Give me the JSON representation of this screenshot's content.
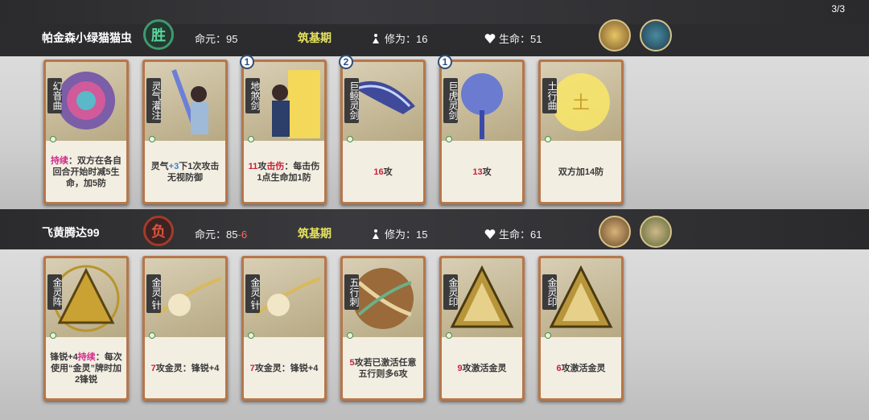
{
  "round_counter": "3/3",
  "players": [
    {
      "name": "帕金森小绿猫猫虫",
      "result": "胜",
      "life_origin_label": "命元：",
      "life_origin_value": "95",
      "life_origin_delta": "",
      "realm": "筑基期",
      "cultivation_label": "修为：",
      "cultivation_value": "16",
      "health_label": "生命：",
      "health_value": "51",
      "cards": [
        {
          "name": "幻音曲",
          "level": "",
          "text_parts": [
            [
              "pink",
              "持续"
            ],
            [
              "",
              "：双方在各自回合开始时减5生命，加5防"
            ]
          ],
          "art": "flower"
        },
        {
          "name": "灵气灌注",
          "level": "",
          "text_parts": [
            [
              "",
              "灵气"
            ],
            [
              "blue",
              "+3"
            ],
            [
              "",
              "下1次攻击无视防御"
            ]
          ],
          "art": "sword-man"
        },
        {
          "name": "地煞剑",
          "level": "1",
          "text_parts": [
            [
              "red",
              "11"
            ],
            [
              "",
              "攻"
            ],
            [
              "red",
              "击伤"
            ],
            [
              "",
              "：每击伤1点生命加1防"
            ]
          ],
          "art": "sword-man2"
        },
        {
          "name": "巨鲸灵剑",
          "level": "2",
          "text_parts": [
            [
              "red",
              "16"
            ],
            [
              "",
              "攻"
            ]
          ],
          "art": "whale"
        },
        {
          "name": "巨虎灵剑",
          "level": "1",
          "text_parts": [
            [
              "red",
              "13"
            ],
            [
              "",
              "攻"
            ]
          ],
          "art": "tiger"
        },
        {
          "name": "土行曲",
          "level": "",
          "text_parts": [
            [
              "",
              "双方加14防"
            ]
          ],
          "art": "earth"
        }
      ]
    },
    {
      "name": "飞黄腾达99",
      "result": "负",
      "life_origin_label": "命元：",
      "life_origin_value": "85",
      "life_origin_delta": "-6",
      "realm": "筑基期",
      "cultivation_label": "修为：",
      "cultivation_value": "15",
      "health_label": "生命：",
      "health_value": "61",
      "cards": [
        {
          "name": "金灵阵",
          "level": "",
          "text_parts": [
            [
              "",
              "锋锐+4"
            ],
            [
              "pink",
              "持续"
            ],
            [
              "",
              "：每次使用“金灵”牌时加2锋锐"
            ]
          ],
          "art": "triangle"
        },
        {
          "name": "金灵·针",
          "level": "",
          "text_parts": [
            [
              "red",
              "7"
            ],
            [
              "",
              "攻"
            ],
            [
              "",
              "金灵：锋锐+4"
            ]
          ],
          "art": "needle"
        },
        {
          "name": "金灵·针",
          "level": "",
          "text_parts": [
            [
              "red",
              "7"
            ],
            [
              "",
              "攻"
            ],
            [
              "",
              "金灵：锋锐+4"
            ]
          ],
          "art": "needle"
        },
        {
          "name": "五行刺",
          "level": "",
          "text_parts": [
            [
              "red",
              "5"
            ],
            [
              "",
              "攻"
            ],
            [
              "",
              "若已激活任意五行则多6攻"
            ]
          ],
          "art": "five"
        },
        {
          "name": "金灵印",
          "level": "",
          "text_parts": [
            [
              "red",
              "9"
            ],
            [
              "",
              "攻"
            ],
            [
              "",
              "激活金灵"
            ]
          ],
          "art": "seal"
        },
        {
          "name": "金灵印",
          "level": "",
          "text_parts": [
            [
              "red",
              "6"
            ],
            [
              "",
              "攻"
            ],
            [
              "",
              "激活金灵"
            ]
          ],
          "art": "seal"
        }
      ]
    }
  ]
}
